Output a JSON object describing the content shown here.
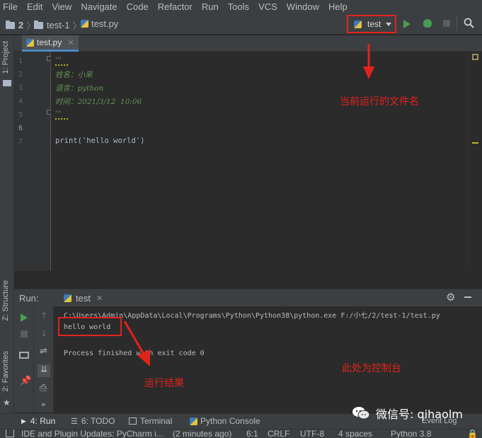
{
  "menubar": [
    "File",
    "Edit",
    "View",
    "Navigate",
    "Code",
    "Refactor",
    "Run",
    "Tools",
    "VCS",
    "Window",
    "Help"
  ],
  "breadcrumb": {
    "project": "2",
    "folder": "test-1",
    "file": "test.py"
  },
  "run_config": {
    "name": "test"
  },
  "left_tabs": {
    "project": "1: Project",
    "structure": "Z: Structure",
    "favorites": "2: Favorites"
  },
  "editor": {
    "tab_label": "test.py",
    "line_numbers": [
      "1",
      "2",
      "3",
      "4",
      "5",
      "6",
      "7"
    ],
    "lines": [
      "'''",
      "姓名：小呆",
      "语言：python",
      "时间：2021/3/12  10:06",
      "'''",
      "",
      "print('hello world')"
    ]
  },
  "annotations": {
    "run_file": "当前运行的文件名",
    "result": "运行结果",
    "console": "此处为控制台"
  },
  "run_panel": {
    "label": "Run:",
    "tab": "test",
    "output": [
      "C:\\Users\\Admin\\AppData\\Local\\Programs\\Python\\Python38\\python.exe F:/小七/2/test-1/test.py",
      "hello world",
      "",
      "Process finished with exit code 0"
    ]
  },
  "bottom_tabs": {
    "run": "4: Run",
    "todo": "6: TODO",
    "terminal": "Terminal",
    "python_console": "Python Console",
    "event_log": "Event Log"
  },
  "statusbar": {
    "message": "IDE and Plugin Updates: PyCharm i...",
    "time": "(2 minutes ago)",
    "position": "6:1",
    "line_sep": "CRLF",
    "encoding": "UTF-8",
    "indent": "4 spaces",
    "interpreter": "Python 3.8"
  },
  "watermark": "微信号: qihaolm",
  "colors": {
    "annotation_red": "#e2231a",
    "accent_green": "#499c54"
  }
}
